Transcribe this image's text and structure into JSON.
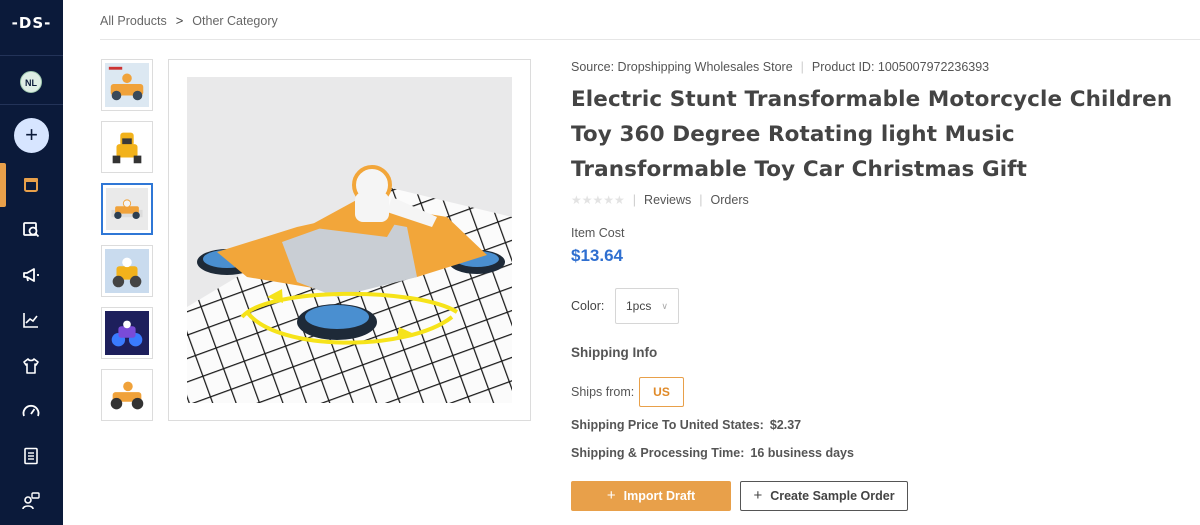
{
  "sidebar": {
    "logo": "-DS-",
    "avatar_initials": "NL",
    "add_symbol": "+",
    "active_accent": "#e8a04a",
    "bg_color": "#0b1a3a",
    "items": [
      {
        "icon": "store-icon"
      },
      {
        "icon": "product-search-icon"
      },
      {
        "icon": "megaphone-icon"
      },
      {
        "icon": "chart-icon"
      },
      {
        "icon": "tshirt-icon"
      },
      {
        "icon": "speedometer-icon"
      },
      {
        "icon": "document-icon"
      },
      {
        "icon": "support-chat-icon"
      }
    ]
  },
  "breadcrumb": {
    "root": "All Products",
    "separator": ">",
    "current": "Other Category"
  },
  "gallery": {
    "selected_index": 2,
    "thumbnails": [
      "thumbnail-1",
      "thumbnail-2",
      "thumbnail-3",
      "thumbnail-4",
      "thumbnail-5",
      "thumbnail-6"
    ]
  },
  "product": {
    "source": "Source: Dropshipping Wholesales Store",
    "product_id": "Product ID: 1005007972236393",
    "title": "Electric Stunt Transformable Motorcycle Children Toy 360 Degree Rotating light Music Transformable Toy Car Christmas Gift",
    "stars": "★★★★★",
    "reviews_label": "Reviews",
    "orders_label": "Orders",
    "item_cost_label": "Item Cost",
    "item_cost_value": "$13.64",
    "color_label": "Color:",
    "color_value": "1pcs",
    "price_color": "#2f6fd0"
  },
  "shipping": {
    "heading": "Shipping Info",
    "ships_from_label": "Ships from:",
    "ships_from_value": "US",
    "price_label": "Shipping Price To United States:",
    "price_value": "$2.37",
    "time_label": "Shipping & Processing Time:",
    "time_value": "16 business days"
  },
  "actions": {
    "import_label": "Import Draft",
    "sample_label": "Create Sample Order",
    "plus": "+"
  }
}
